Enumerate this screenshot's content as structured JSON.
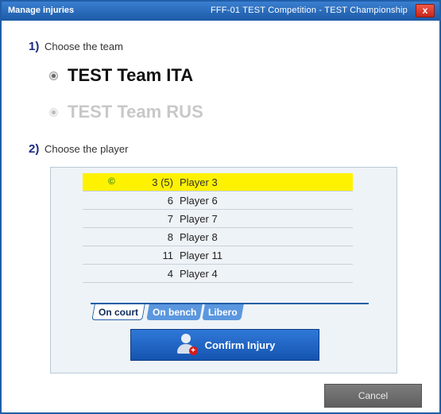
{
  "window": {
    "title": "Manage injuries",
    "subtitle": "FFF-01  TEST Competition - TEST Championship",
    "close_label": "x"
  },
  "step1": {
    "number": "1)",
    "label": "Choose the team"
  },
  "teams": [
    {
      "name": "TEST Team ITA",
      "selected": true
    },
    {
      "name": "TEST Team RUS",
      "selected": false
    }
  ],
  "step2": {
    "number": "2)",
    "label": "Choose the player"
  },
  "players": [
    {
      "captain": "©",
      "number": "3 (5)",
      "name": "Player 3",
      "selected": true
    },
    {
      "captain": "",
      "number": "6",
      "name": "Player 6",
      "selected": false
    },
    {
      "captain": "",
      "number": "7",
      "name": "Player 7",
      "selected": false
    },
    {
      "captain": "",
      "number": "8",
      "name": "Player 8",
      "selected": false
    },
    {
      "captain": "",
      "number": "11",
      "name": "Player 11",
      "selected": false
    },
    {
      "captain": "",
      "number": "4",
      "name": "Player 4",
      "selected": false
    }
  ],
  "tabs": [
    {
      "label": "On court",
      "active": true
    },
    {
      "label": "On bench",
      "active": false
    },
    {
      "label": "Libero",
      "active": false
    }
  ],
  "confirm_label": "Confirm Injury",
  "cancel_label": "Cancel",
  "colors": {
    "titlebar": "#1f5ea8",
    "selected_row": "#fff200",
    "confirm_button": "#1f66c8",
    "cancel_button": "#6e6e6e"
  }
}
